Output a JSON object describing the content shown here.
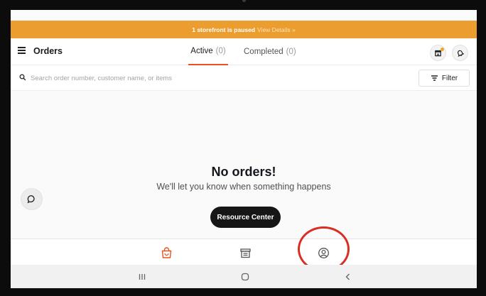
{
  "banner": {
    "message": "1 storefront is paused",
    "link": "View Details »"
  },
  "header": {
    "title": "Orders",
    "menu_icon": "hamburger-menu-icon",
    "store_icon": "store-icon",
    "notification_icon": "bell-icon",
    "notification_dot_color": "#f4a621"
  },
  "tabs": [
    {
      "label": "Active",
      "count": "(0)",
      "active": true
    },
    {
      "label": "Completed",
      "count": "(0)",
      "active": false
    }
  ],
  "search": {
    "placeholder": "Search order number, customer name, or items",
    "value": "",
    "icon": "search-icon"
  },
  "filter": {
    "label": "Filter",
    "icon": "filter-lines-icon"
  },
  "empty_state": {
    "title": "No orders!",
    "subtitle": "We'll let you know when something happens",
    "button_label": "Resource Center"
  },
  "chat": {
    "icon": "chat-bubble-icon"
  },
  "tab_bar": [
    {
      "icon": "shopping-bag-icon",
      "selected": true
    },
    {
      "icon": "menu-card-icon",
      "selected": false
    },
    {
      "icon": "account-circle-icon",
      "selected": false
    }
  ],
  "system_nav": [
    {
      "icon": "recents-icon"
    },
    {
      "icon": "home-icon"
    },
    {
      "icon": "back-icon"
    }
  ],
  "colors": {
    "banner_bg": "#ec9d2f",
    "accent": "#e8531d",
    "annotation": "#d92e23",
    "button_dark": "#161616"
  }
}
